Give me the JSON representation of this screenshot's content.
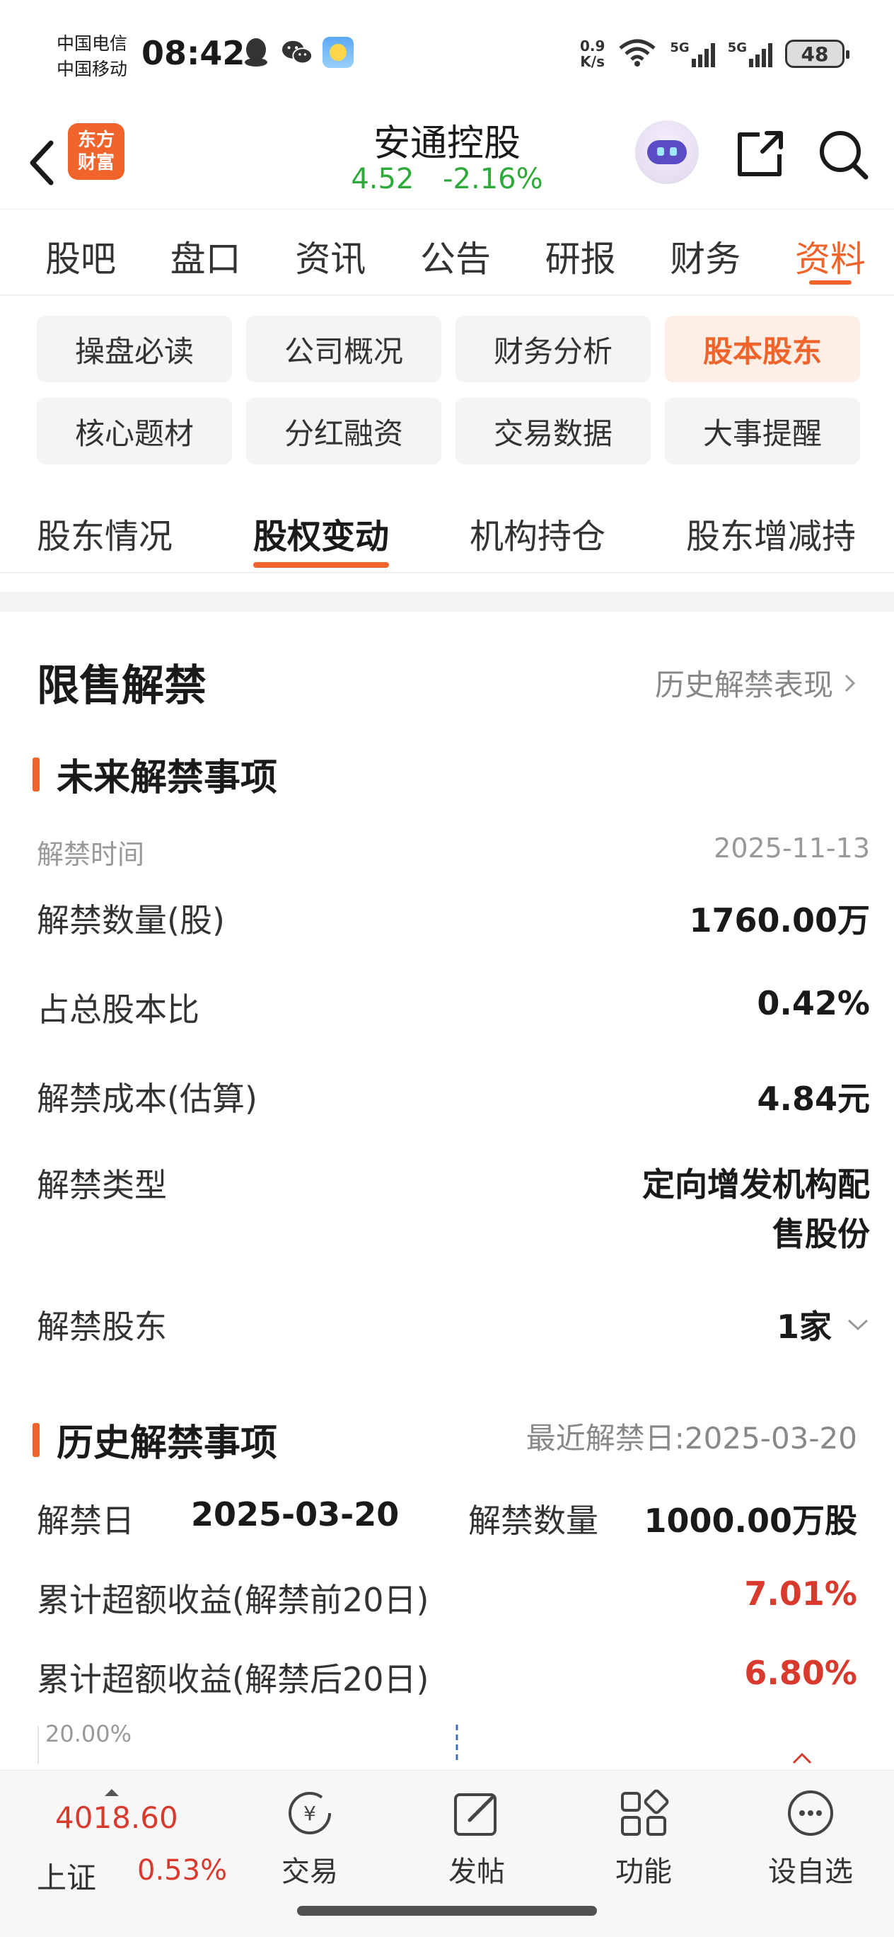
{
  "status_bar": {
    "carrier_1": "中国电信",
    "carrier_2": "中国移动",
    "time": "08:42",
    "net_speed_value": "0.9",
    "net_speed_unit": "K/s",
    "signal_1_label": "5G",
    "signal_2_label": "5G",
    "battery": "48",
    "icons": [
      "qq-icon",
      "wechat-icon",
      "weather-icon",
      "wifi-icon",
      "signal-icon",
      "battery-icon"
    ]
  },
  "header": {
    "logo_line1": "东方",
    "logo_line2": "财富",
    "stock_name": "安通控股",
    "price": "4.52",
    "change": "-2.16%",
    "price_color": "#2eaa3a"
  },
  "main_tabs": [
    "股吧",
    "盘口",
    "资讯",
    "公告",
    "研报",
    "财务",
    "资料"
  ],
  "main_tab_active": "资料",
  "categories": [
    "操盘必读",
    "公司概况",
    "财务分析",
    "股本股东",
    "核心题材",
    "分红融资",
    "交易数据",
    "大事提醒"
  ],
  "category_active": "股本股东",
  "section_tabs": [
    "股东情况",
    "股权变动",
    "机构持仓",
    "股东增减持"
  ],
  "section_tab_active": "股权变动",
  "restricted": {
    "title": "限售解禁",
    "history_link": "历史解禁表现",
    "future_title": "未来解禁事项",
    "rows": {
      "time_label": "解禁时间",
      "time_value": "2025-11-13",
      "qty_label": "解禁数量(股)",
      "qty_value": "1760.00万",
      "ratio_label": "占总股本比",
      "ratio_value": "0.42%",
      "cost_label": "解禁成本(估算)",
      "cost_value": "4.84元",
      "type_label": "解禁类型",
      "type_value": "定向增发机构配售股份",
      "holder_label": "解禁股东",
      "holder_value": "1家"
    },
    "history_title": "历史解禁事项",
    "latest_date": "最近解禁日:2025-03-20",
    "history": {
      "date_label": "解禁日",
      "date_value": "2025-03-20",
      "qty_label": "解禁数量",
      "qty_value": "1000.00万股",
      "pre_label": "累计超额收益(解禁前20日)",
      "pre_value": "7.01%",
      "post_label": "累计超额收益(解禁后20日)",
      "post_value": "6.80%"
    },
    "chart_tick": "20.00%"
  },
  "bottom_nav": {
    "index_value": "4018.60",
    "index_name": "上证",
    "index_change": "0.53%",
    "items": [
      "交易",
      "发帖",
      "功能",
      "设自选"
    ]
  },
  "colors": {
    "accent": "#f0642c",
    "up_red": "#d83a2d",
    "down_green": "#2eaa3a"
  }
}
